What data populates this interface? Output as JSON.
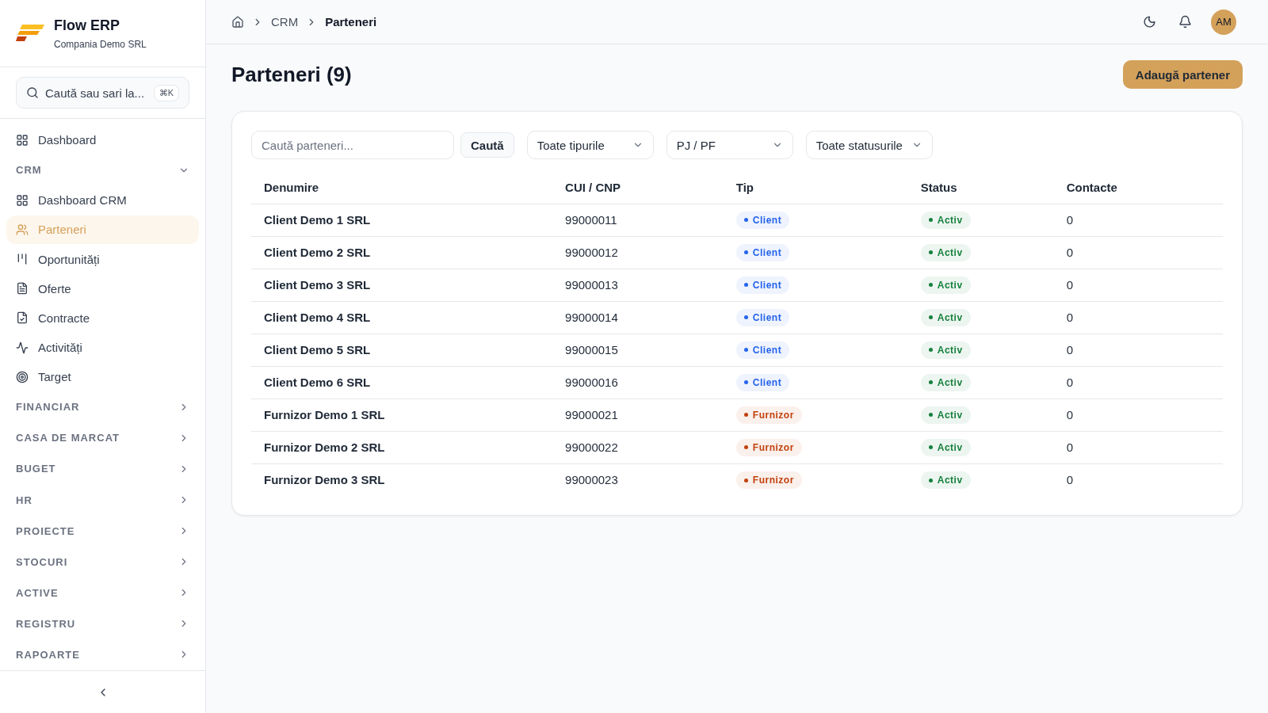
{
  "brand": {
    "name": "Flow ERP",
    "company": "Compania Demo SRL"
  },
  "sidebar": {
    "search": {
      "placeholder": "Caută sau sari la...",
      "shortcut": "⌘K"
    },
    "top_items": [
      {
        "label": "Dashboard",
        "selected": false
      }
    ],
    "groups": [
      {
        "label": "CRM",
        "expanded": true,
        "items": [
          {
            "label": "Dashboard CRM",
            "selected": false
          },
          {
            "label": "Parteneri",
            "selected": true
          },
          {
            "label": "Oportunități",
            "selected": false
          },
          {
            "label": "Oferte",
            "selected": false
          },
          {
            "label": "Contracte",
            "selected": false
          },
          {
            "label": "Activități",
            "selected": false
          },
          {
            "label": "Target",
            "selected": false
          }
        ]
      },
      {
        "label": "FINANCIAR",
        "expanded": false
      },
      {
        "label": "CASA DE MARCAT",
        "expanded": false
      },
      {
        "label": "BUGET",
        "expanded": false
      },
      {
        "label": "HR",
        "expanded": false
      },
      {
        "label": "PROIECTE",
        "expanded": false
      },
      {
        "label": "STOCURI",
        "expanded": false
      },
      {
        "label": "ACTIVE",
        "expanded": false
      },
      {
        "label": "REGISTRU",
        "expanded": false
      },
      {
        "label": "RAPOARTE",
        "expanded": false
      }
    ]
  },
  "breadcrumb": [
    "CRM",
    "Parteneri"
  ],
  "user": {
    "initials": "AM"
  },
  "page": {
    "title": "Parteneri (9)",
    "add_button": "Adaugă partener"
  },
  "filters": {
    "search": {
      "placeholder": "Caută parteneri..."
    },
    "search_button": "Caută",
    "selects": [
      "Toate tipurile",
      "PJ / PF",
      "Toate statusurile"
    ]
  },
  "table": {
    "columns": [
      "Denumire",
      "CUI / CNP",
      "Tip",
      "Status",
      "Contacte"
    ],
    "rows": [
      {
        "name": "Client Demo 1 SRL",
        "cui": "99000011",
        "type": {
          "label": "Client",
          "color": "#2563eb"
        },
        "status": {
          "label": "Activ",
          "color": "#15803d"
        },
        "contacts": "0"
      },
      {
        "name": "Client Demo 2 SRL",
        "cui": "99000012",
        "type": {
          "label": "Client",
          "color": "#2563eb"
        },
        "status": {
          "label": "Activ",
          "color": "#15803d"
        },
        "contacts": "0"
      },
      {
        "name": "Client Demo 3 SRL",
        "cui": "99000013",
        "type": {
          "label": "Client",
          "color": "#2563eb"
        },
        "status": {
          "label": "Activ",
          "color": "#15803d"
        },
        "contacts": "0"
      },
      {
        "name": "Client Demo 4 SRL",
        "cui": "99000014",
        "type": {
          "label": "Client",
          "color": "#2563eb"
        },
        "status": {
          "label": "Activ",
          "color": "#15803d"
        },
        "contacts": "0"
      },
      {
        "name": "Client Demo 5 SRL",
        "cui": "99000015",
        "type": {
          "label": "Client",
          "color": "#2563eb"
        },
        "status": {
          "label": "Activ",
          "color": "#15803d"
        },
        "contacts": "0"
      },
      {
        "name": "Client Demo 6 SRL",
        "cui": "99000016",
        "type": {
          "label": "Client",
          "color": "#2563eb"
        },
        "status": {
          "label": "Activ",
          "color": "#15803d"
        },
        "contacts": "0"
      },
      {
        "name": "Furnizor Demo 1 SRL",
        "cui": "99000021",
        "type": {
          "label": "Furnizor",
          "color": "#c2410c"
        },
        "status": {
          "label": "Activ",
          "color": "#15803d"
        },
        "contacts": "0"
      },
      {
        "name": "Furnizor Demo 2 SRL",
        "cui": "99000022",
        "type": {
          "label": "Furnizor",
          "color": "#c2410c"
        },
        "status": {
          "label": "Activ",
          "color": "#15803d"
        },
        "contacts": "0"
      },
      {
        "name": "Furnizor Demo 3 SRL",
        "cui": "99000023",
        "type": {
          "label": "Furnizor",
          "color": "#c2410c"
        },
        "status": {
          "label": "Activ",
          "color": "#15803d"
        },
        "contacts": "0"
      }
    ]
  }
}
